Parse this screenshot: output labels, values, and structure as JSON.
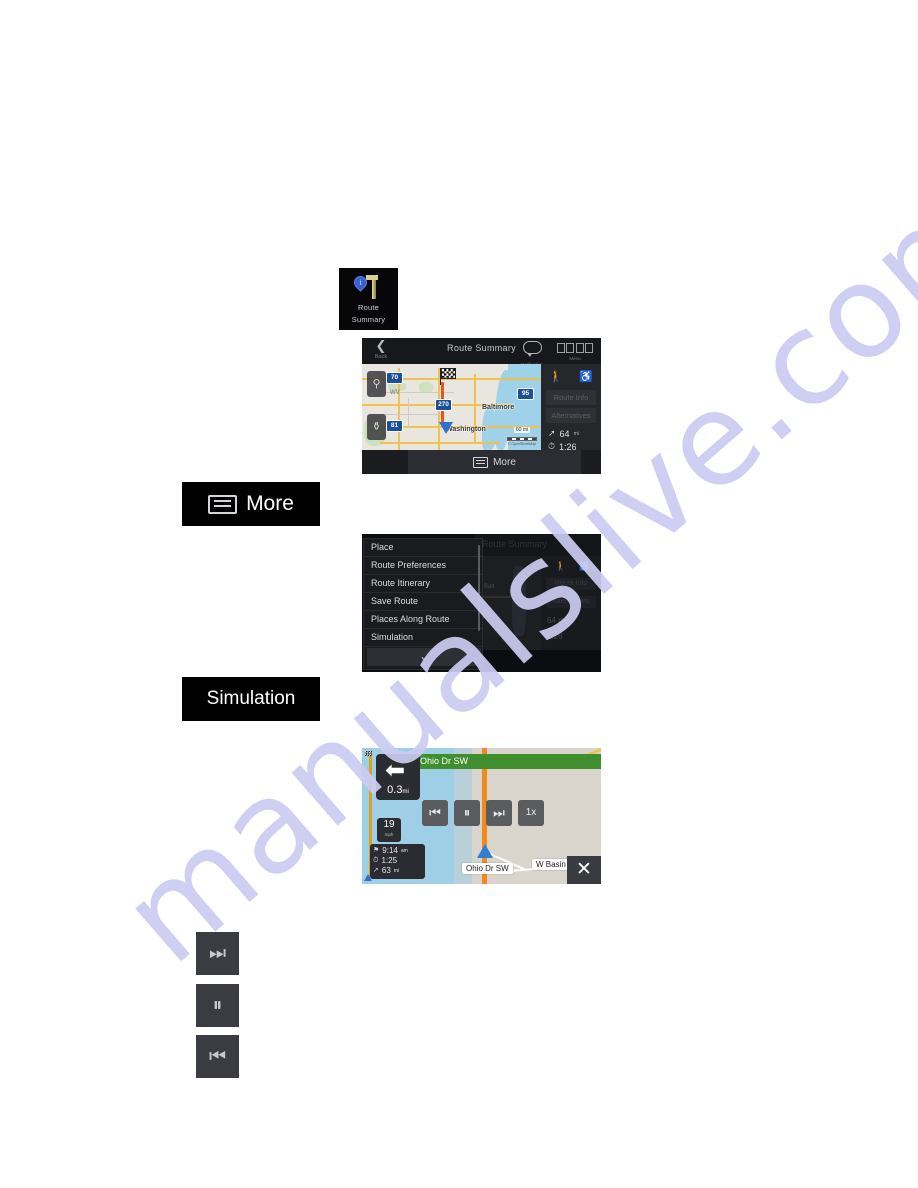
{
  "watermark": {
    "text": "manualslive.com"
  },
  "icon_tile": {
    "name": "route-summary-icon",
    "label_line1": "Route",
    "label_line2": "Summary"
  },
  "route_summary_screen": {
    "header": {
      "back_label": "Back",
      "title": "Route Summary",
      "notification_label": "Notification",
      "menu_label": "Menu"
    },
    "map": {
      "cities": [
        {
          "name": "Baltimore"
        },
        {
          "name": "Washington"
        }
      ],
      "state_label": "WV",
      "shields": [
        "70",
        "95",
        "270",
        "81"
      ],
      "zoom_in": "+",
      "zoom_out": "-",
      "scale_value": "60 mi",
      "scale_copyright": "© OpenStreetMap"
    },
    "rail": {
      "pedestrian_icon": "pedestrian-icon",
      "accessibility_icon": "wheelchair-icon",
      "route_info_label": "Route Info",
      "alternatives_label": "Alternatives",
      "distance_value": "64",
      "distance_unit": "mi",
      "time_value": "1:26"
    },
    "more_button_label": "More"
  },
  "more_button": {
    "label": "More",
    "icon": "more-lines-icon"
  },
  "more_menu_screen": {
    "items": [
      "Place",
      "Route Preferences",
      "Route Itinerary",
      "Save Route",
      "Places Along Route",
      "Simulation"
    ],
    "scroll_down_icon": "chevron-down-icon",
    "background": {
      "title": "Route Summary",
      "city1": "Balt",
      "city2": "Was",
      "route_info_label": "Route Info",
      "alternatives_label": "Alternatives",
      "distance_value": "64 mi",
      "time_value": "1:26"
    }
  },
  "simulation_button": {
    "label": "Simulation"
  },
  "navigation_screen": {
    "street_banner": "Ohio Dr SW",
    "turn": {
      "arrow_icon": "turn-left-icon",
      "distance": "0.3",
      "unit": "mi"
    },
    "speed": {
      "value": "19",
      "unit": "mph"
    },
    "stats": [
      {
        "icon": "arrival-flag-icon",
        "value": "9:14",
        "unit": "am"
      },
      {
        "icon": "clock-icon",
        "value": "1:25",
        "unit": ""
      },
      {
        "icon": "distance-icon",
        "value": "63",
        "unit": "mi"
      }
    ],
    "controls": [
      {
        "name": "skip-back-button",
        "glyph": "⏮"
      },
      {
        "name": "pause-button",
        "glyph": "⏸"
      },
      {
        "name": "skip-forward-button",
        "glyph": "⏭"
      },
      {
        "name": "speed-multiplier-button",
        "glyph": "1x"
      }
    ],
    "street_labels": [
      "Ohio Dr SW",
      "W Basin Dr SW"
    ],
    "close_icon": "close-icon"
  },
  "legend_buttons": [
    {
      "name": "skip-forward-button",
      "glyph": "⏭"
    },
    {
      "name": "pause-button",
      "glyph": "⏸"
    },
    {
      "name": "skip-back-button",
      "glyph": "⏮"
    }
  ]
}
